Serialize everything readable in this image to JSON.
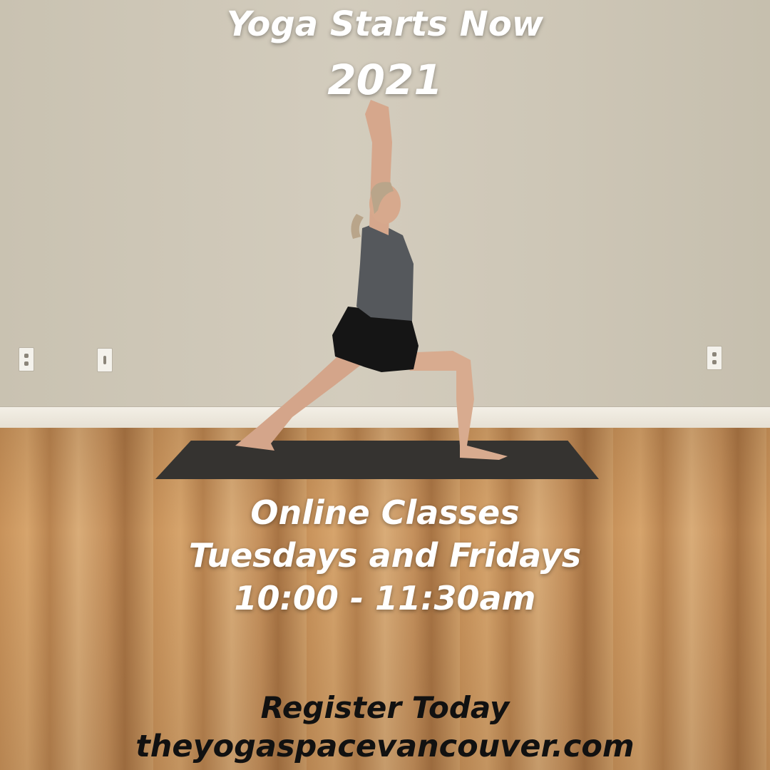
{
  "headline": "Yoga Starts Now",
  "year": "2021",
  "schedule": {
    "line1": "Online Classes",
    "line2": "Tuesdays and Fridays",
    "line3": "10:00 - 11:30am"
  },
  "cta": {
    "register": "Register Today",
    "website": "theyogaspacevancouver.com"
  },
  "colors": {
    "overlay_text": "#ffffff",
    "cta_text": "#111111",
    "mat": "#353330",
    "shirt": "#55585c",
    "shorts": "#151515"
  }
}
